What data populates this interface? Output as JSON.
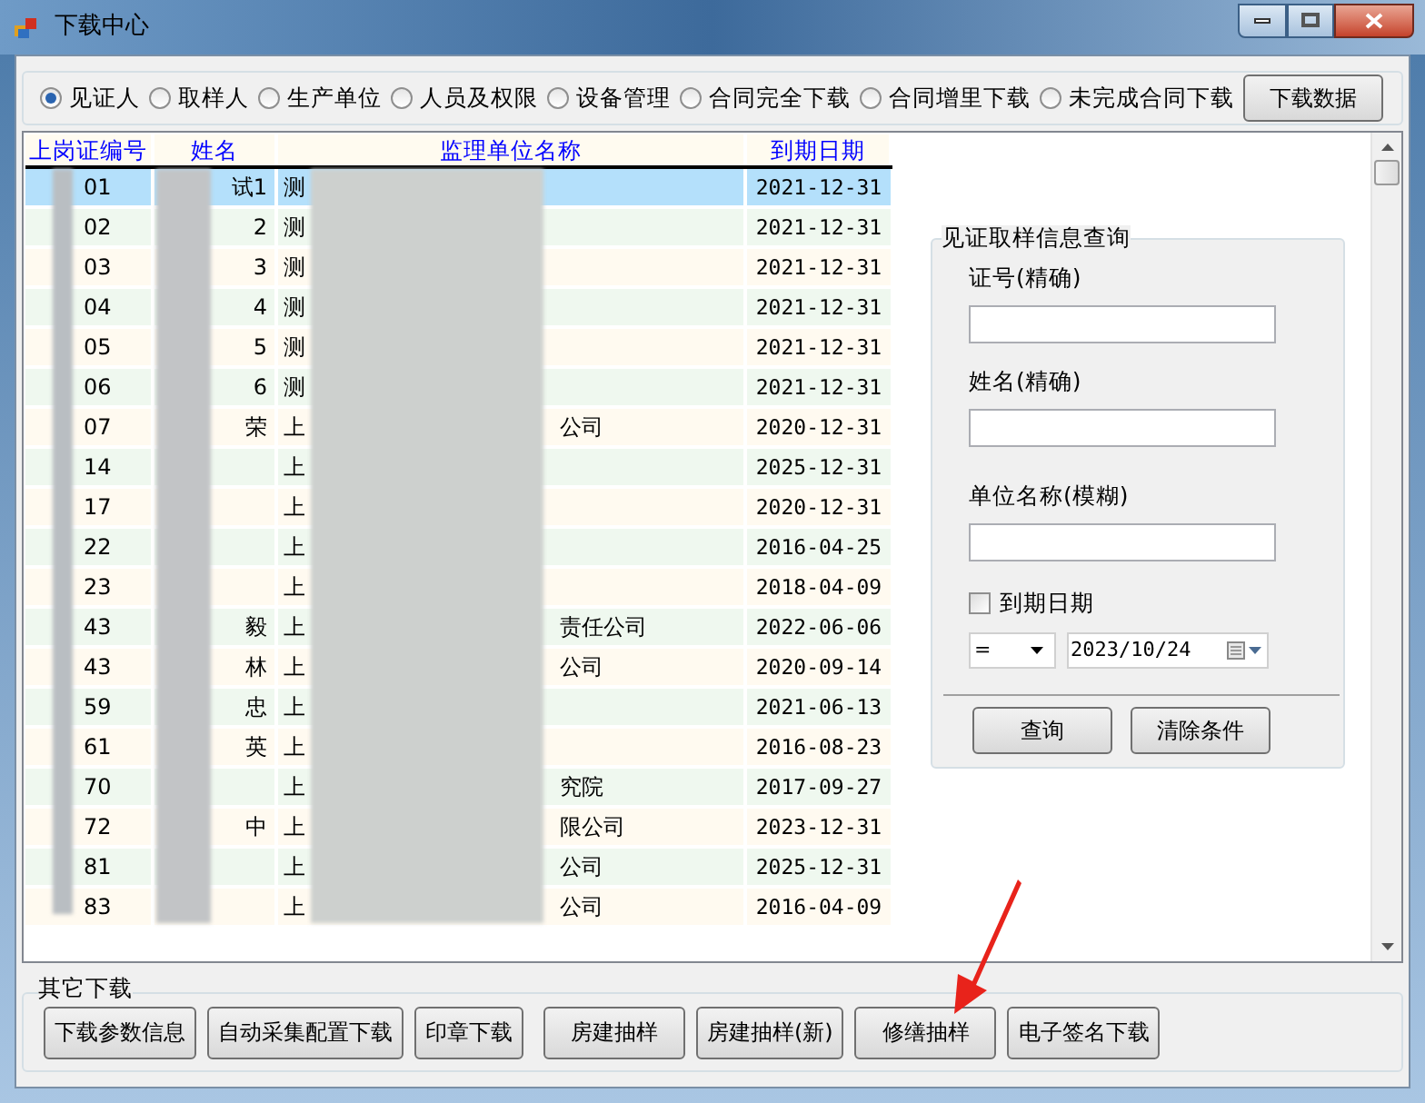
{
  "window": {
    "title": "下载中心"
  },
  "options": [
    {
      "label": "见证人",
      "selected": true
    },
    {
      "label": "取样人",
      "selected": false
    },
    {
      "label": "生产单位",
      "selected": false
    },
    {
      "label": "人员及权限",
      "selected": false
    },
    {
      "label": "设备管理",
      "selected": false
    },
    {
      "label": "合同完全下载",
      "selected": false
    },
    {
      "label": "合同增里下载",
      "selected": false
    },
    {
      "label": "未完成合同下载",
      "selected": false
    }
  ],
  "download_button": "下载数据",
  "table": {
    "columns": [
      "上岗证编号",
      "姓名",
      "监理单位名称",
      "到期日期"
    ],
    "rows": [
      {
        "cells": [
          "01",
          "试1",
          "测",
          "2021-12-31"
        ],
        "selected": true
      },
      {
        "cells": [
          "02",
          "2",
          "测",
          "2021-12-31"
        ],
        "selected": false
      },
      {
        "cells": [
          "03",
          "3",
          "测",
          "2021-12-31"
        ],
        "selected": false
      },
      {
        "cells": [
          "04",
          "4",
          "测",
          "2021-12-31"
        ],
        "selected": false
      },
      {
        "cells": [
          "05",
          "5",
          "测",
          "2021-12-31"
        ],
        "selected": false
      },
      {
        "cells": [
          "06",
          "6",
          "测",
          "2021-12-31"
        ],
        "selected": false
      },
      {
        "cells": [
          "07",
          "荣",
          "上",
          "2020-12-31"
        ],
        "unit_end": "公司",
        "selected": false
      },
      {
        "cells": [
          "14",
          "",
          "上",
          "2025-12-31"
        ],
        "selected": false
      },
      {
        "cells": [
          "17",
          "",
          "上",
          "2020-12-31"
        ],
        "selected": false
      },
      {
        "cells": [
          "22",
          "",
          "上",
          "2016-04-25"
        ],
        "selected": false
      },
      {
        "cells": [
          "23",
          "",
          "上",
          "2018-04-09"
        ],
        "selected": false
      },
      {
        "cells": [
          "43",
          "毅",
          "上",
          "2022-06-06"
        ],
        "unit_end": "责任公司",
        "selected": false
      },
      {
        "cells": [
          "43",
          "林",
          "上",
          "2020-09-14"
        ],
        "unit_end": "公司",
        "selected": false
      },
      {
        "cells": [
          "59",
          "忠",
          "上",
          "2021-06-13"
        ],
        "selected": false
      },
      {
        "cells": [
          "61",
          "英",
          "上",
          "2016-08-23"
        ],
        "selected": false
      },
      {
        "cells": [
          "70",
          "",
          "上",
          "2017-09-27"
        ],
        "unit_end": "究院",
        "selected": false
      },
      {
        "cells": [
          "72",
          "中",
          "上",
          "2023-12-31"
        ],
        "unit_end": "限公司",
        "selected": false
      },
      {
        "cells": [
          "81",
          "",
          "上",
          "2025-12-31"
        ],
        "unit_end": "公司",
        "selected": false
      },
      {
        "cells": [
          "83",
          "",
          "上",
          "2016-04-09"
        ],
        "unit_end": "公司",
        "selected": false
      }
    ]
  },
  "query": {
    "title": "见证取样信息查询",
    "fields": [
      {
        "label": "证号(精确)"
      },
      {
        "label": "姓名(精确)"
      },
      {
        "label": "单位名称(模糊)"
      }
    ],
    "date_filter": {
      "label": "到期日期",
      "checked": false,
      "operator": "=",
      "date": "2023/10/24"
    },
    "buttons": [
      "查询",
      "清除条件"
    ]
  },
  "other_downloads": {
    "title": "其它下载",
    "buttons": [
      "下载参数信息",
      "自动采集配置下载",
      "印章下载",
      "房建抽样",
      "房建抽样(新)",
      "修缮抽样",
      "电子签名下载"
    ]
  }
}
